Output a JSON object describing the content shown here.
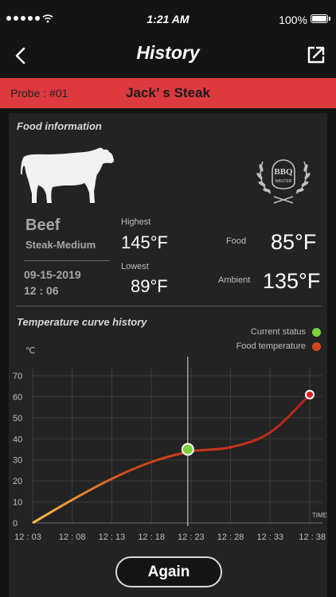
{
  "status_bar": {
    "time": "1:21 AM",
    "battery": "100%"
  },
  "header": {
    "title": "History"
  },
  "probe": {
    "label": "Probe : #01",
    "name": "Jack’ s Steak"
  },
  "food_info": {
    "section_title": "Food information",
    "badge_top": "BBQ",
    "badge_bottom": "MASTER",
    "meat": "Beef",
    "doneness": "Steak-Medium",
    "date": "09-15-2019",
    "time": "12 : 06",
    "highest_label": "Highest",
    "highest_value": "145°F",
    "lowest_label": "Lowest",
    "lowest_value": "89°F",
    "food_label": "Food",
    "food_value": "85°F",
    "ambient_label": "Ambient",
    "ambient_value": "135°F"
  },
  "chart_section": {
    "title": "Temperature curve history",
    "legend_current": "Current status",
    "legend_food": "Food temperature",
    "colors": {
      "current": "#7cd33a",
      "food": "#d2481d",
      "food_start": "#f4c14a"
    }
  },
  "chart_data": {
    "type": "line",
    "ylabel": "℃",
    "xlabel": "TIME",
    "ylim": [
      0,
      70
    ],
    "yticks": [
      0,
      10,
      20,
      30,
      40,
      50,
      60,
      70
    ],
    "categories": [
      "12 : 03",
      "12 : 08",
      "12 : 13",
      "12 : 18",
      "12 : 23",
      "12 : 28",
      "12 : 33",
      "12 : 38"
    ],
    "series": [
      {
        "values": [
          0,
          11,
          21,
          29,
          34,
          36,
          43,
          55
        ]
      }
    ],
    "end_point": {
      "x": "12 : 38",
      "y": 61
    },
    "current_point": {
      "x": "12 : 23",
      "y": 35
    },
    "grid": true
  },
  "footer": {
    "again_label": "Again"
  }
}
